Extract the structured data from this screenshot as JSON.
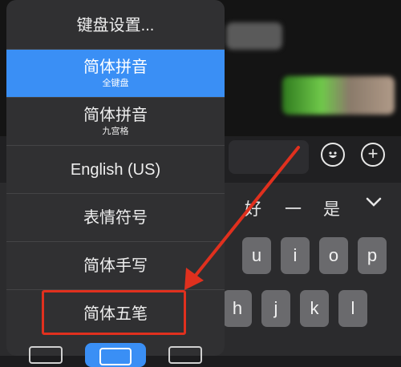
{
  "menu": {
    "items": [
      {
        "label": "键盘设置...",
        "sub": ""
      },
      {
        "label": "简体拼音",
        "sub": "全键盘",
        "selected": true
      },
      {
        "label": "简体拼音",
        "sub": "九宫格"
      },
      {
        "label": "English (US)",
        "sub": ""
      },
      {
        "label": "表情符号",
        "sub": ""
      },
      {
        "label": "简体手写",
        "sub": ""
      },
      {
        "label": "简体五笔",
        "sub": ""
      }
    ],
    "selected_color": "#3a8ff5"
  },
  "candidates": [
    "好",
    "一",
    "是"
  ],
  "keys": {
    "row1": [
      "u",
      "i",
      "o",
      "p"
    ],
    "row2": [
      "h",
      "j",
      "k",
      "l"
    ]
  },
  "buttons": {
    "emoji_icon": "smiley-icon",
    "plus_label": "+"
  },
  "annotation": {
    "highlight_color": "#e0301e",
    "target": "简体五笔"
  }
}
